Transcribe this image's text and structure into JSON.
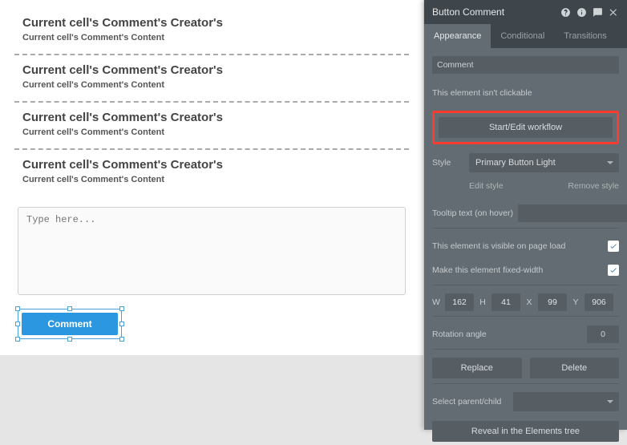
{
  "canvas": {
    "comments": [
      {
        "creator": "Current cell's Comment's Creator's",
        "content": "Current cell's Comment's Content"
      },
      {
        "creator": "Current cell's Comment's Creator's",
        "content": "Current cell's Comment's Content"
      },
      {
        "creator": "Current cell's Comment's Creator's",
        "content": "Current cell's Comment's Content"
      },
      {
        "creator": "Current cell's Comment's Creator's",
        "content": "Current cell's Comment's Content"
      }
    ],
    "textarea_placeholder": "Type here...",
    "comment_button_label": "Comment"
  },
  "panel": {
    "title": "Button Comment",
    "tabs": {
      "appearance": "Appearance",
      "conditional": "Conditional",
      "transitions": "Transitions"
    },
    "name_value": "Comment",
    "not_clickable_label": "This element isn't clickable",
    "workflow_button": "Start/Edit workflow",
    "style_label": "Style",
    "style_value": "Primary Button Light",
    "edit_style": "Edit style",
    "remove_style": "Remove style",
    "tooltip_label": "Tooltip text (on hover)",
    "tooltip_value": "",
    "visible_label": "This element is visible on page load",
    "visible_checked": true,
    "fixed_width_label": "Make this element fixed-width",
    "fixed_width_checked": true,
    "dims": {
      "w_label": "W",
      "w": "162",
      "h_label": "H",
      "h": "41",
      "x_label": "X",
      "x": "99",
      "y_label": "Y",
      "y": "906"
    },
    "rotation_label": "Rotation angle",
    "rotation_value": "0",
    "replace_label": "Replace",
    "delete_label": "Delete",
    "select_parent_label": "Select parent/child",
    "reveal_label": "Reveal in the Elements tree"
  }
}
